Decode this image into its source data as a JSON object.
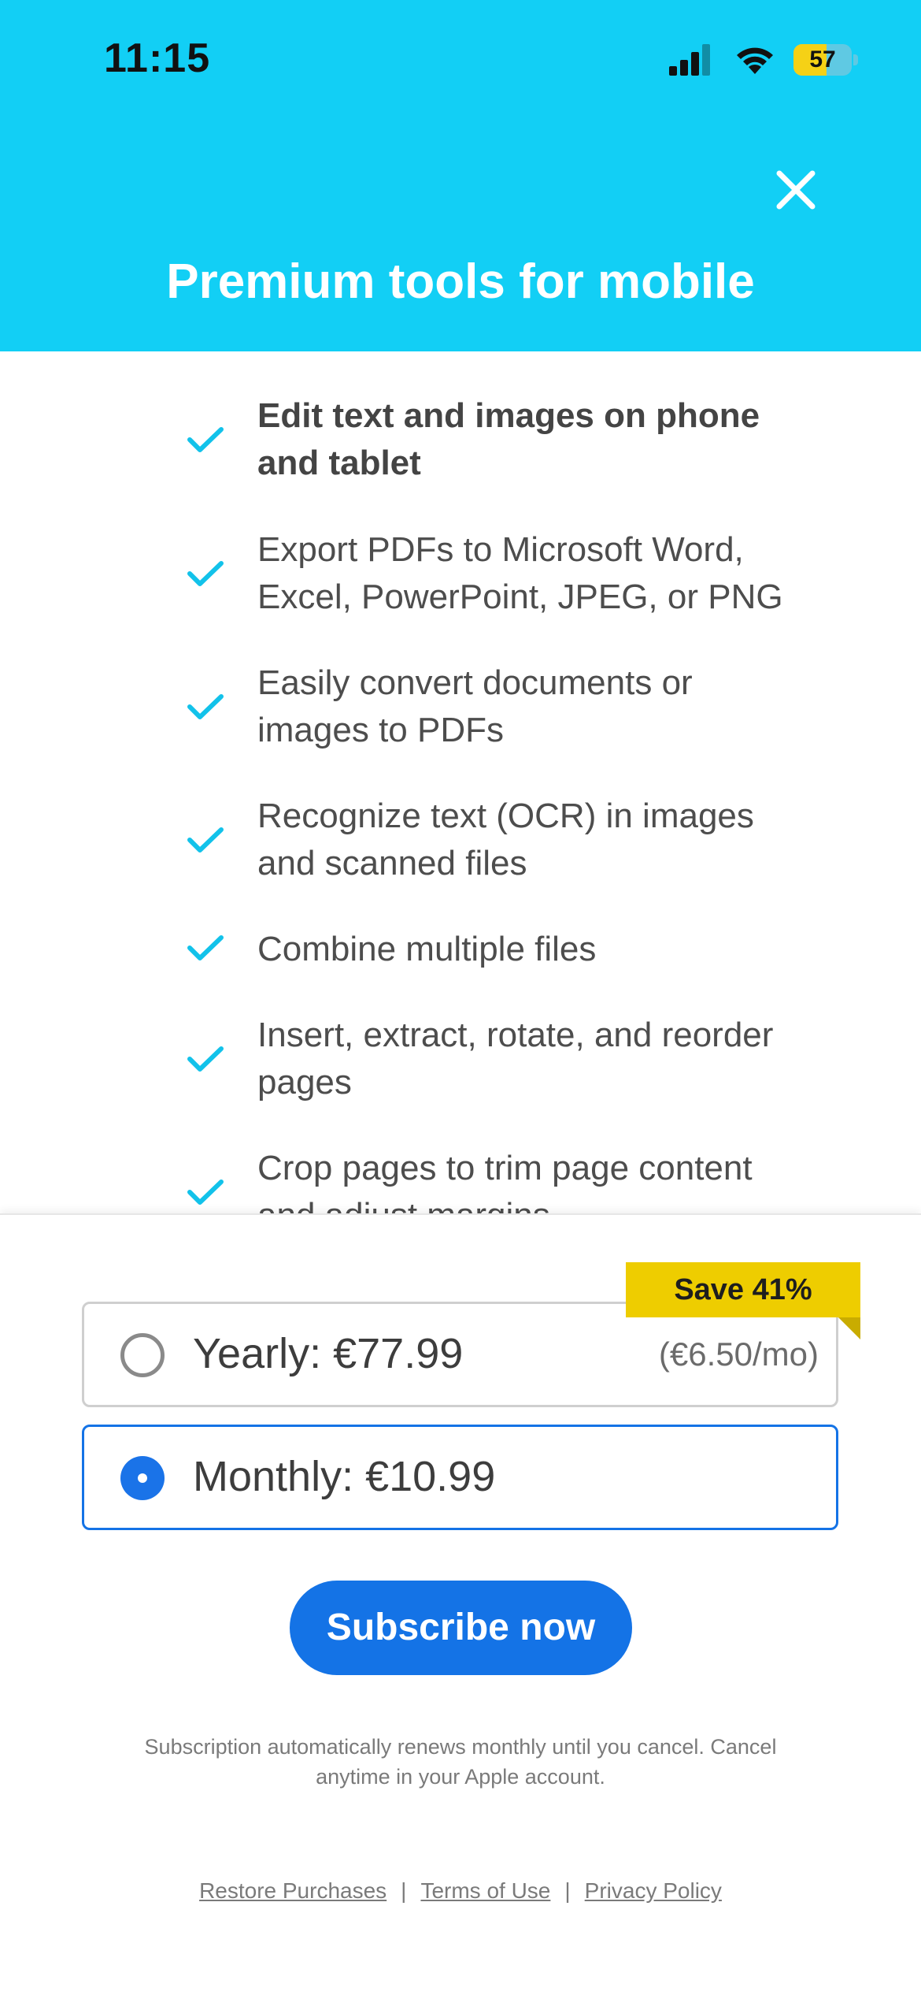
{
  "status_bar": {
    "time": "11:15",
    "battery_level": "57",
    "battery_fraction": 0.57,
    "icons": [
      "cellular-signal-icon",
      "wifi-icon",
      "battery-icon"
    ]
  },
  "header": {
    "title": "Premium tools for mobile",
    "background_color": "#12cff5",
    "close_icon": "close-icon"
  },
  "features": [
    {
      "text": "Edit text and images on phone and tablet",
      "bold": true
    },
    {
      "text": "Export PDFs to Microsoft Word, Excel, PowerPoint, JPEG, or PNG",
      "bold": false
    },
    {
      "text": "Easily convert documents or images to PDFs",
      "bold": false
    },
    {
      "text": "Recognize text (OCR) in images and scanned files",
      "bold": false
    },
    {
      "text": "Combine multiple files",
      "bold": false
    },
    {
      "text": "Insert, extract, rotate, and reorder pages",
      "bold": false
    },
    {
      "text": "Crop pages to trim page content and adjust margins",
      "bold": false
    }
  ],
  "plans": {
    "yearly": {
      "label": "Yearly: €77.99",
      "per_month": "(€6.50/mo)",
      "selected": false,
      "badge": "Save 41%"
    },
    "monthly": {
      "label": "Monthly: €10.99",
      "selected": true
    }
  },
  "subscribe_button": "Subscribe now",
  "disclaimer": "Subscription automatically renews monthly until you cancel. Cancel anytime in your Apple account.",
  "footer_links": {
    "restore": "Restore Purchases",
    "terms": "Terms of Use",
    "privacy": "Privacy Policy",
    "separator": "|"
  },
  "colors": {
    "accent_blue": "#1473e6",
    "check_cyan": "#12c2ea",
    "badge_yellow": "#eecd00"
  }
}
